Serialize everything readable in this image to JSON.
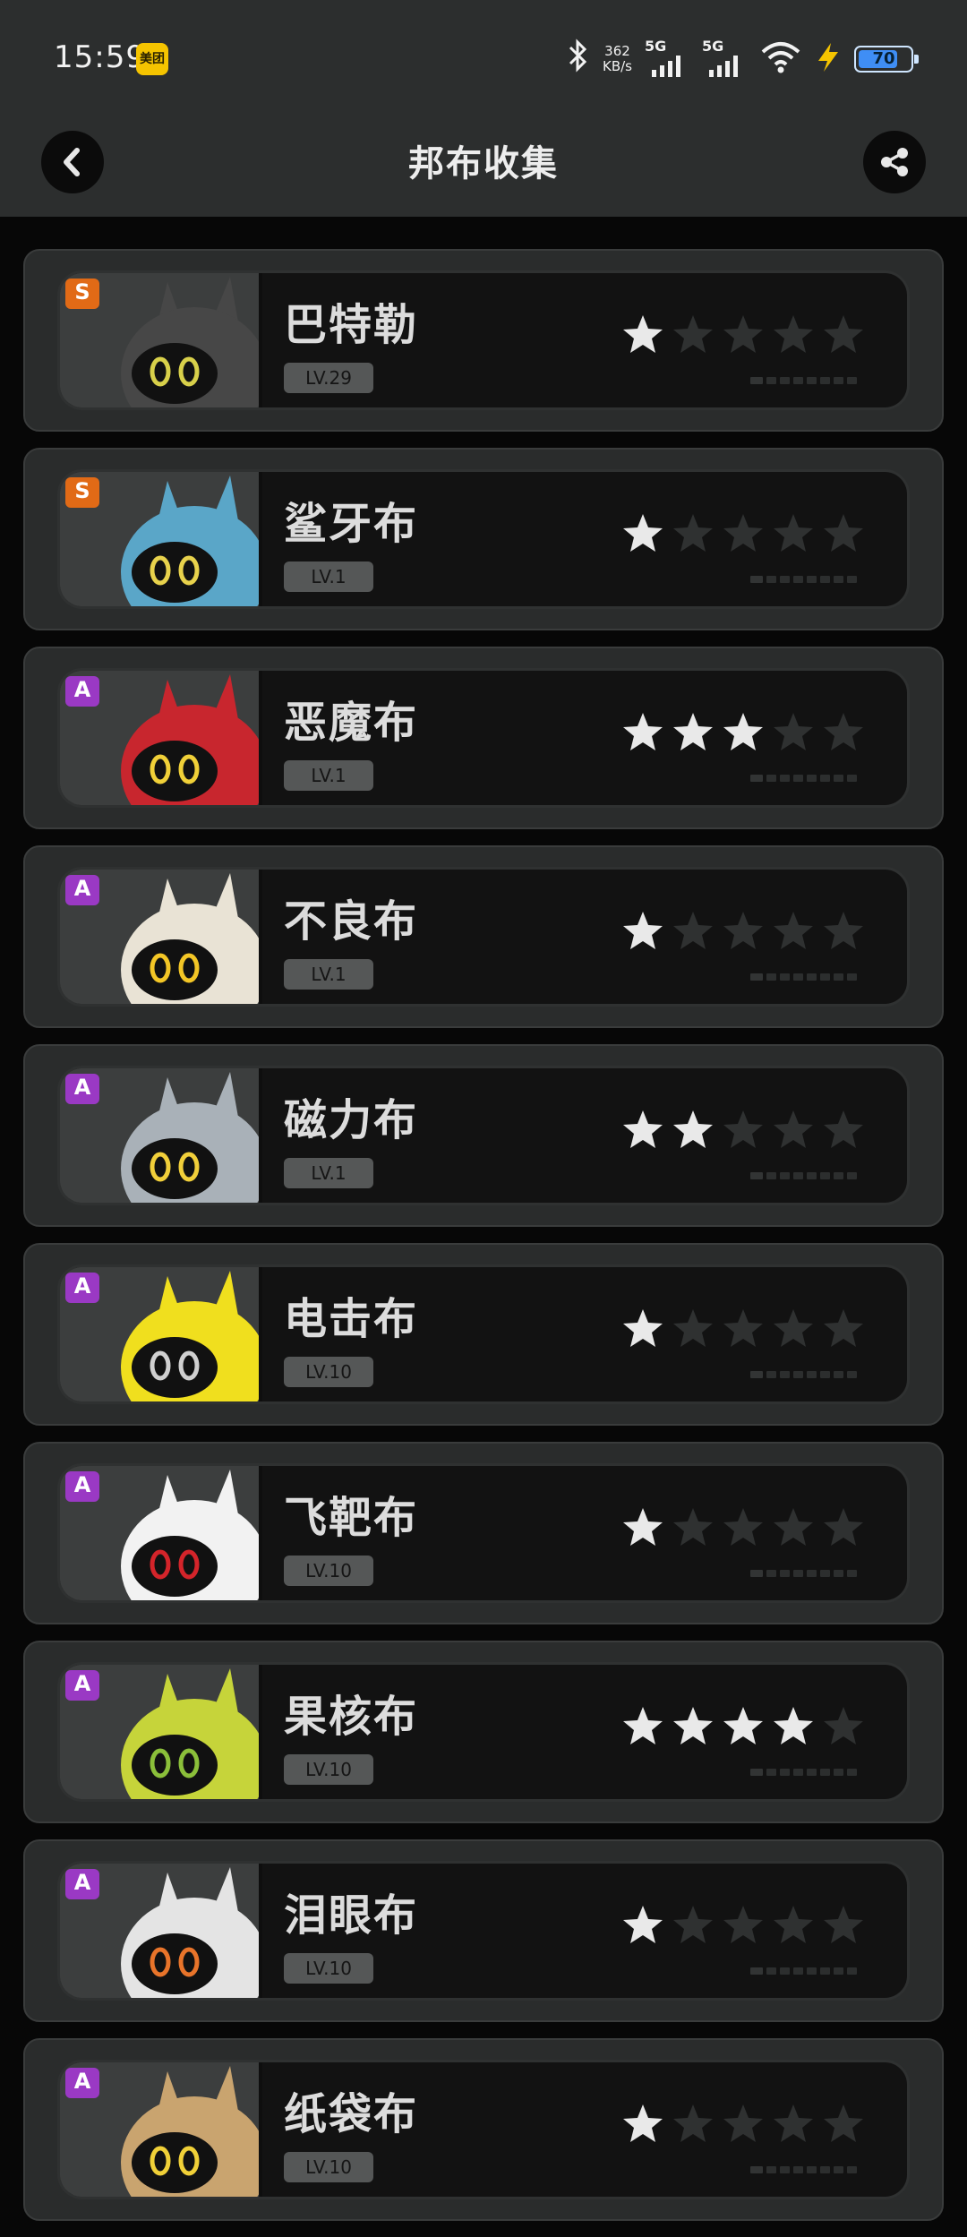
{
  "status_bar": {
    "time": "15:59",
    "badge": "美团",
    "speed_value": "362",
    "speed_unit": "KB/s",
    "signal1": "5G",
    "signal2": "5G",
    "battery": "70"
  },
  "header": {
    "title": "邦布收集"
  },
  "cards": [
    {
      "name": "巴特勒",
      "rank": "S",
      "level": "LV.29",
      "stars": 1,
      "art_color": "#474747",
      "accent": "#d8d04a"
    },
    {
      "name": "鲨牙布",
      "rank": "S",
      "level": "LV.1",
      "stars": 1,
      "art_color": "#5aa6c8",
      "accent": "#e8d24c"
    },
    {
      "name": "恶魔布",
      "rank": "A",
      "level": "LV.1",
      "stars": 3,
      "art_color": "#c8262e",
      "accent": "#f0d038"
    },
    {
      "name": "不良布",
      "rank": "A",
      "level": "LV.1",
      "stars": 1,
      "art_color": "#e9e3d5",
      "accent": "#f3c626"
    },
    {
      "name": "磁力布",
      "rank": "A",
      "level": "LV.1",
      "stars": 2,
      "art_color": "#a9b1b8",
      "accent": "#f1cf3a"
    },
    {
      "name": "电击布",
      "rank": "A",
      "level": "LV.10",
      "stars": 1,
      "art_color": "#f0df1e",
      "accent": "#d0d0d0"
    },
    {
      "name": "飞靶布",
      "rank": "A",
      "level": "LV.10",
      "stars": 1,
      "art_color": "#f2f2f2",
      "accent": "#d4242a"
    },
    {
      "name": "果核布",
      "rank": "A",
      "level": "LV.10",
      "stars": 4,
      "art_color": "#c6d43a",
      "accent": "#8bbf3a"
    },
    {
      "name": "泪眼布",
      "rank": "A",
      "level": "LV.10",
      "stars": 1,
      "art_color": "#e4e4e4",
      "accent": "#e8742a"
    },
    {
      "name": "纸袋布",
      "rank": "A",
      "level": "LV.10",
      "stars": 1,
      "art_color": "#c9a46f",
      "accent": "#f0d038"
    }
  ]
}
